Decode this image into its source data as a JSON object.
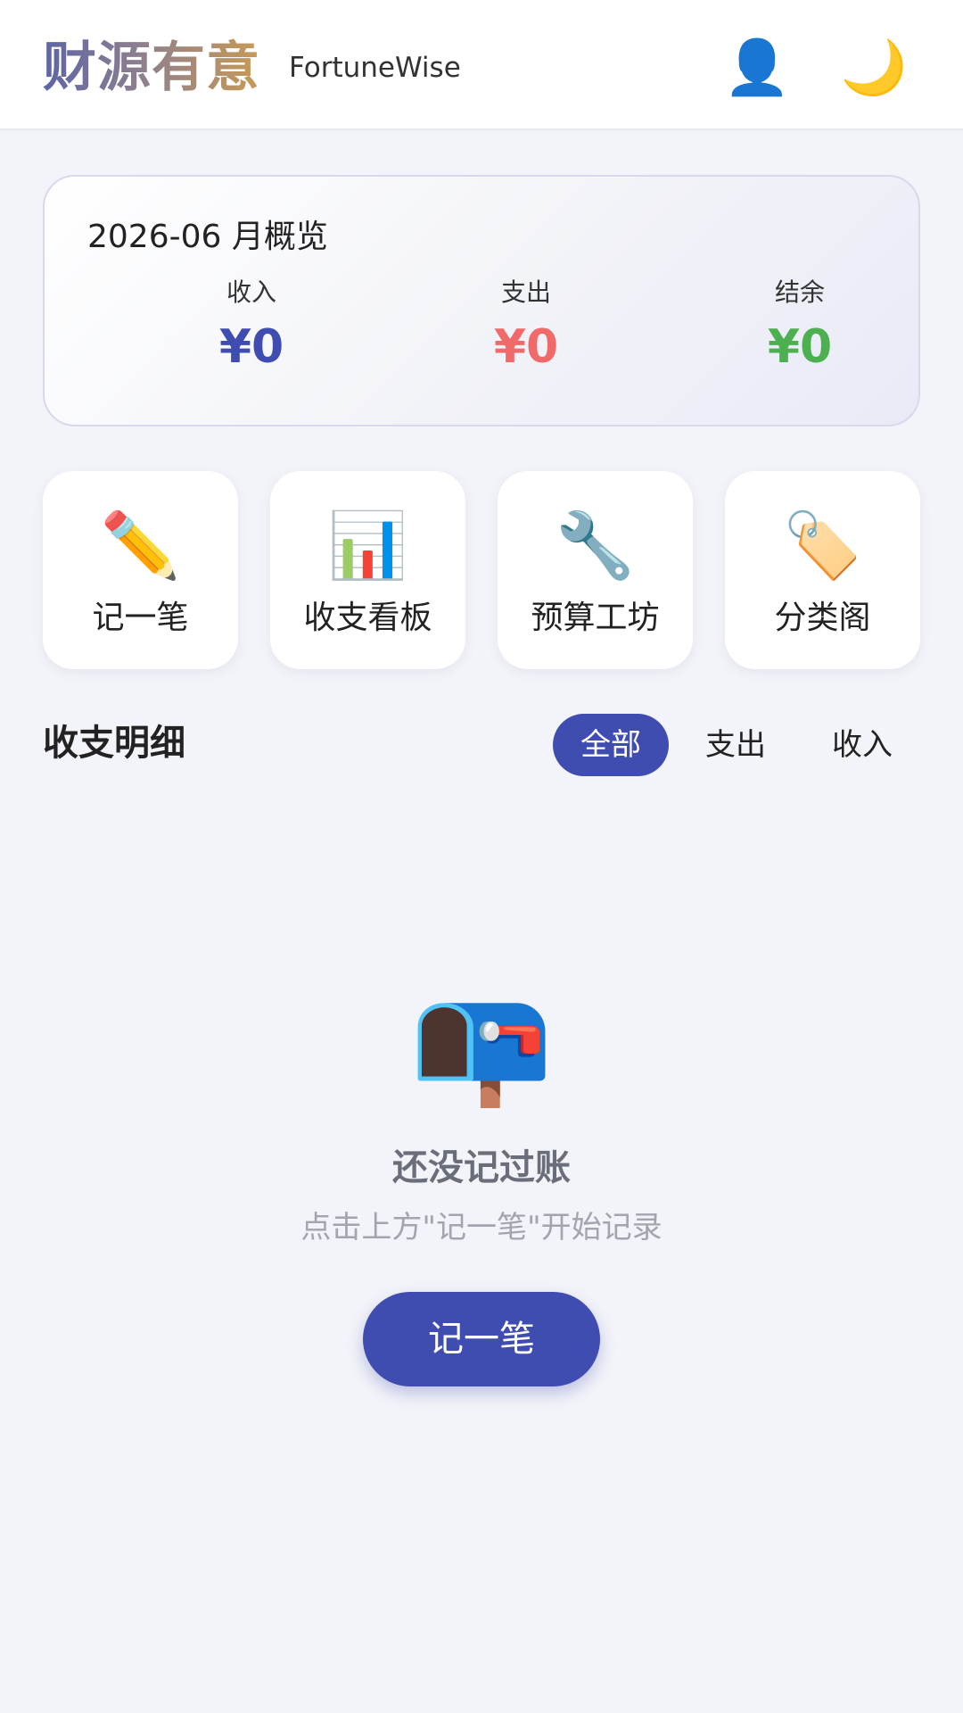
{
  "header": {
    "brand": "财源有意",
    "brand_en": "FortuneWise",
    "user_icon": "user-icon",
    "theme_icon": "moon-icon",
    "user_glyph": "👤",
    "theme_glyph": "🌙"
  },
  "summary": {
    "title": "2026-06 月概览",
    "income_label": "收入",
    "income_value": "¥0",
    "expense_label": "支出",
    "expense_value": "¥0",
    "balance_label": "结余",
    "balance_value": "¥0"
  },
  "actions": [
    {
      "icon": "pencil-icon",
      "glyph": "✏️",
      "label": "记一笔"
    },
    {
      "icon": "bar-chart-icon",
      "glyph": "📊",
      "label": "收支看板"
    },
    {
      "icon": "wrench-icon",
      "glyph": "🔧",
      "label": "预算工坊"
    },
    {
      "icon": "tag-icon",
      "glyph": "🏷️",
      "label": "分类阁"
    }
  ],
  "details": {
    "title": "收支明细",
    "filters": [
      "全部",
      "支出",
      "收入"
    ],
    "selected_filter": "全部"
  },
  "empty_state": {
    "icon": "mailbox-icon",
    "glyph": "📭",
    "title": "还没记过账",
    "subtitle": "点击上方\"记一笔\"开始记录",
    "button_label": "记一笔"
  },
  "colors": {
    "accent": "#3f4cb0",
    "income": "#3f4cb0",
    "expense": "#f06a6a",
    "balance": "#4caf50",
    "background": "#f3f4f9"
  }
}
